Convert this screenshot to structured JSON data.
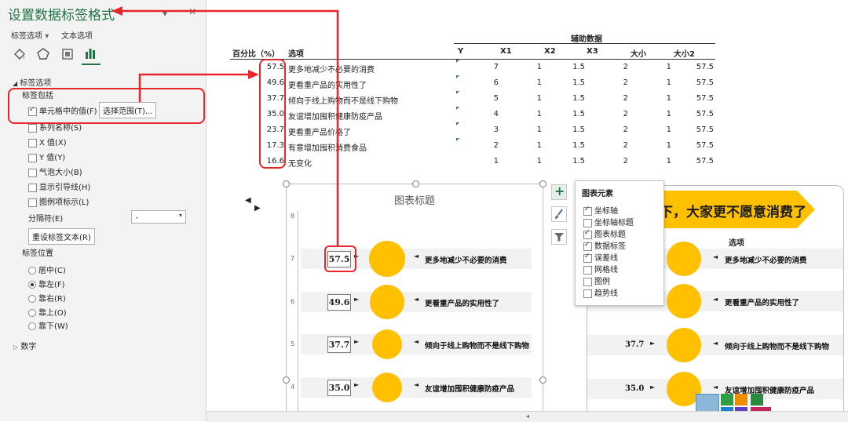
{
  "pane": {
    "title": "设置数据标签格式",
    "tabs": [
      "标签选项",
      "文本选项"
    ],
    "section_label": "标签选项",
    "label_contains": "标签包括",
    "checkboxes": [
      {
        "label": "单元格中的值(F)",
        "checked": true
      },
      {
        "label": "系列名称(S)",
        "checked": false
      },
      {
        "label": "X 值(X)",
        "checked": false
      },
      {
        "label": "Y 值(Y)",
        "checked": false
      },
      {
        "label": "气泡大小(B)",
        "checked": false
      },
      {
        "label": "显示引导线(H)",
        "checked": false
      },
      {
        "label": "图例项标示(L)",
        "checked": false
      }
    ],
    "select_range_button": "选择范围(T)...",
    "separator_label": "分隔符(E)",
    "separator_value": ",",
    "reset_button": "重设标签文本(R)",
    "position_label": "标签位置",
    "positions": [
      {
        "label": "居中(C)",
        "checked": false
      },
      {
        "label": "靠左(F)",
        "checked": true
      },
      {
        "label": "靠右(R)",
        "checked": false
      },
      {
        "label": "靠上(O)",
        "checked": false
      },
      {
        "label": "靠下(W)",
        "checked": false
      }
    ],
    "number_section": "数字"
  },
  "table": {
    "group_header": "辅助数据",
    "headers": [
      "百分比（%）",
      "选项",
      "Y",
      "X1",
      "X2",
      "X3",
      "大小",
      "大小2"
    ],
    "rows": [
      [
        "57.5",
        "更多地减少不必要的消费",
        "7",
        "1",
        "1.5",
        "2",
        "1",
        "57.5"
      ],
      [
        "49.6",
        "更看重产品的实用性了",
        "6",
        "1",
        "1.5",
        "2",
        "1",
        "57.5"
      ],
      [
        "37.7",
        "倾向于线上购物而不是线下购物",
        "5",
        "1",
        "1.5",
        "2",
        "1",
        "57.5"
      ],
      [
        "35.0",
        "友谊增加囤积健康防疫产品",
        "4",
        "1",
        "1.5",
        "2",
        "1",
        "57.5"
      ],
      [
        "23.7",
        "更看重产品价格了",
        "3",
        "1",
        "1.5",
        "2",
        "1",
        "57.5"
      ],
      [
        "17.3",
        "有意增加囤积消费食品",
        "2",
        "1",
        "1.5",
        "2",
        "1",
        "57.5"
      ],
      [
        "16.6",
        "无变化",
        "1",
        "1",
        "1.5",
        "2",
        "1",
        "57.5"
      ]
    ]
  },
  "chart": {
    "title": "图表标题",
    "y_ticks": [
      "8",
      "7",
      "6",
      "5",
      "4"
    ],
    "labels": [
      "57.5",
      "49.6",
      "37.7",
      "35.0"
    ],
    "categories": [
      "更多地减少不必要的消费",
      "更看重产品的实用性了",
      "倾向于线上购物而不是线下购物",
      "友谊增加囤积健康防疫产品"
    ]
  },
  "chart_elements": {
    "title": "图表元素",
    "items": [
      {
        "label": "坐标轴",
        "checked": true
      },
      {
        "label": "坐标轴标题",
        "checked": false
      },
      {
        "label": "图表标题",
        "checked": true
      },
      {
        "label": "数据标签",
        "checked": true
      },
      {
        "label": "误差线",
        "checked": true
      },
      {
        "label": "网格线",
        "checked": false
      },
      {
        "label": "图例",
        "checked": false
      },
      {
        "label": "趋势线",
        "checked": false
      }
    ]
  },
  "chart2": {
    "banner": "下，大家更不愿意消费了",
    "header": "选项",
    "rows": [
      {
        "label": "",
        "category": "更多地减少不必要的消费"
      },
      {
        "label": "49.6",
        "category": "更看重产品的实用性了"
      },
      {
        "label": "37.7",
        "category": "倾向于线上购物而不是线下购物"
      },
      {
        "label": "35.0",
        "category": "友谊增加囤积健康防疫产品"
      }
    ]
  },
  "colors": {
    "bubble": "#ffc000",
    "annotation": "#e8262b",
    "accent": "#217346"
  }
}
